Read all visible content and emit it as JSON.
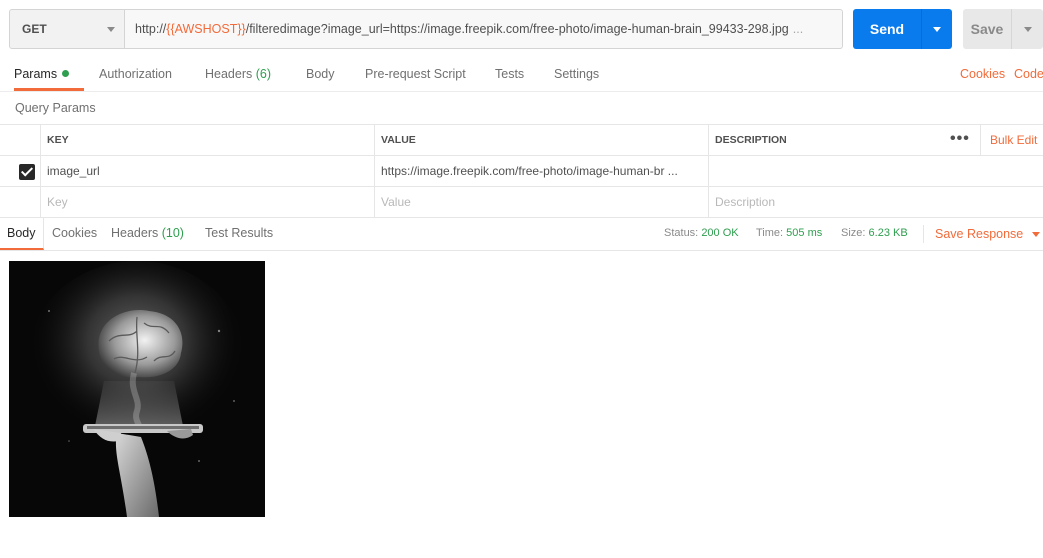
{
  "request": {
    "method": "GET",
    "url": {
      "prefix": "http://",
      "variable": "{{AWSHOST}}",
      "rest": "/filteredimage?image_url=https://image.freepik.com/free-photo/image-human-brain_99433-298.jpg",
      "ellipsis": "..."
    },
    "send_label": "Send",
    "save_label": "Save"
  },
  "request_tabs": {
    "params": "Params",
    "authorization": "Authorization",
    "headers": "Headers",
    "headers_count": "(6)",
    "body": "Body",
    "prerequest": "Pre-request Script",
    "tests": "Tests",
    "settings": "Settings",
    "cookies": "Cookies",
    "code": "Code"
  },
  "query_params": {
    "title": "Query Params",
    "columns": [
      "KEY",
      "VALUE",
      "DESCRIPTION"
    ],
    "bulk_edit": "Bulk Edit",
    "rows": [
      {
        "checked": true,
        "key": "image_url",
        "value": "https://image.freepik.com/free-photo/image-human-br ...",
        "description": ""
      }
    ],
    "placeholder": {
      "key": "Key",
      "value": "Value",
      "description": "Description"
    }
  },
  "response": {
    "tabs": {
      "body": "Body",
      "cookies": "Cookies",
      "headers": "Headers",
      "headers_count": "(10)",
      "test_results": "Test Results"
    },
    "status_label": "Status:",
    "status": "200 OK",
    "time_label": "Time:",
    "time": "505 ms",
    "size_label": "Size:",
    "size": "6.23 KB",
    "save_response": "Save Response"
  },
  "colors": {
    "accent": "#f26b3a",
    "send": "#097bed",
    "success": "#2e9e4f"
  }
}
